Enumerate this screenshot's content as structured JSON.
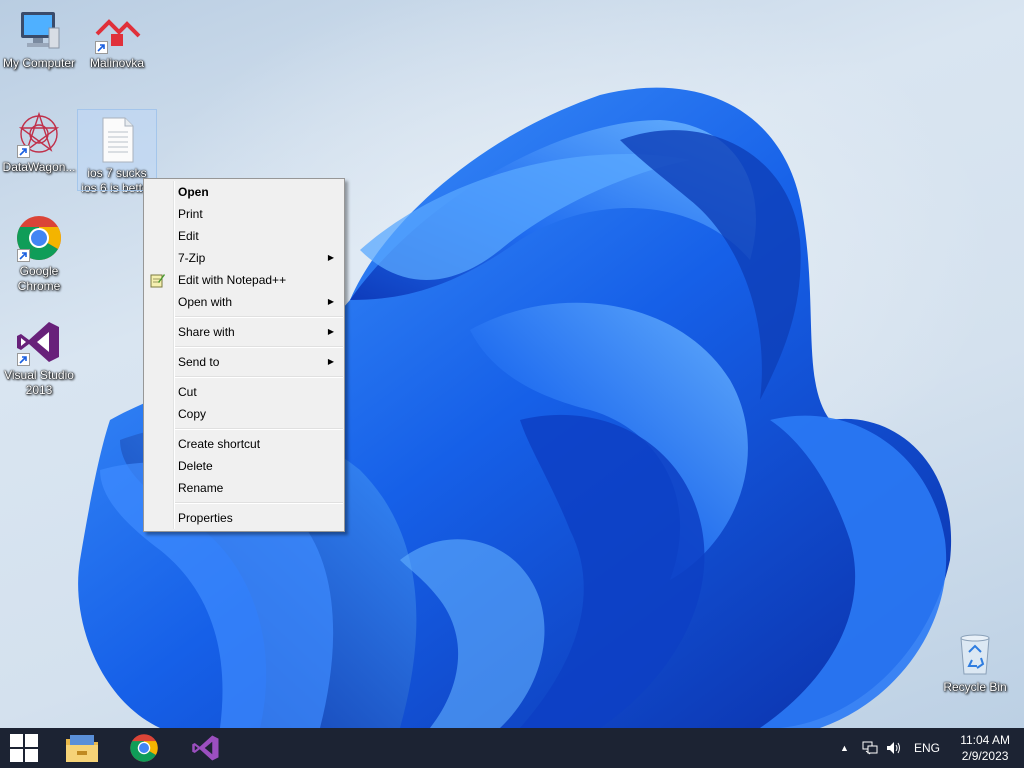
{
  "desktop": {
    "icons": [
      {
        "label": "My Computer"
      },
      {
        "label": "Malinovka"
      },
      {
        "label": "DataWagon..."
      },
      {
        "label": "ios 7 sucks ios 6 is better"
      },
      {
        "label": "Google Chrome"
      },
      {
        "label": "Visual Studio 2013"
      },
      {
        "label": "Recycle Bin"
      }
    ]
  },
  "context_menu": {
    "items": [
      {
        "label": "Open",
        "bold": true
      },
      {
        "label": "Print"
      },
      {
        "label": "Edit"
      },
      {
        "label": "7-Zip",
        "submenu": true
      },
      {
        "label": "Edit with Notepad++",
        "icon": "notepad-plus-icon"
      },
      {
        "label": "Open with",
        "submenu": true
      },
      {
        "label": "Share with",
        "submenu": true
      },
      {
        "label": "Send to",
        "submenu": true
      },
      {
        "label": "Cut"
      },
      {
        "label": "Copy"
      },
      {
        "label": "Create shortcut"
      },
      {
        "label": "Delete"
      },
      {
        "label": "Rename"
      },
      {
        "label": "Properties"
      }
    ]
  },
  "taskbar": {
    "pinned": [
      {
        "icon": "start-windows-icon"
      },
      {
        "icon": "file-explorer-icon"
      },
      {
        "icon": "chrome-icon"
      },
      {
        "icon": "visual-studio-icon"
      }
    ],
    "tray": {
      "language": "ENG",
      "time": "11:04 AM",
      "date": "2/9/2023"
    }
  },
  "colors": {
    "taskbar": "#1c2333",
    "menu_bg": "#f0f0f0",
    "bloom": "#1a5fe0"
  }
}
